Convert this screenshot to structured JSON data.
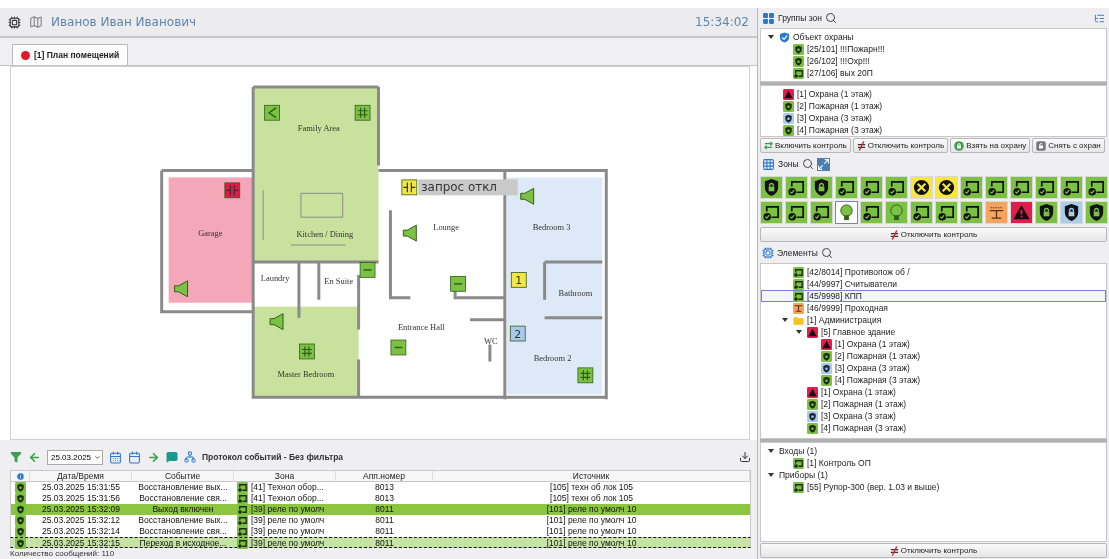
{
  "header": {
    "user": "Иванов Иван Иванович",
    "time": "15:34:02"
  },
  "tabs": [
    {
      "label": "[1] План помещений",
      "selected": true
    }
  ],
  "plan": {
    "areas": [
      {
        "color": "#c8e29d"
      },
      {
        "color": "#c8e29d"
      },
      {
        "color": "#f3a7b9"
      },
      {
        "color": "#dde9f6"
      }
    ],
    "room_labels": [
      "Family Area",
      "Garage",
      "Kitchen / Dining",
      "Laundry",
      "En Suite",
      "Lounge",
      "Bedroom 3",
      "Bathroom",
      "Entrance Hall",
      "WC",
      "Bedroom 2",
      "Master Bedroom"
    ],
    "markers": [
      {
        "kind": "sounder",
        "color": "#7cc242"
      },
      {
        "kind": "panel",
        "color": "#7cc242"
      },
      {
        "kind": "relay",
        "color": "#e0194b"
      },
      {
        "kind": "speaker",
        "color": "#7cc242"
      },
      {
        "kind": "relay",
        "color": "#f5e642",
        "caption": "запрос откл"
      },
      {
        "kind": "speaker",
        "color": "#7cc242"
      },
      {
        "kind": "speaker",
        "color": "#7cc242"
      },
      {
        "kind": "minus",
        "color": "#7cc242"
      },
      {
        "kind": "minus",
        "color": "#7cc242"
      },
      {
        "kind": "number",
        "color": "#f5e642",
        "label": "1"
      },
      {
        "kind": "number",
        "color": "#a9c8ea",
        "label": "2"
      },
      {
        "kind": "minus",
        "color": "#7cc242"
      },
      {
        "kind": "speaker",
        "color": "#7cc242"
      },
      {
        "kind": "panel",
        "color": "#7cc242"
      },
      {
        "kind": "panel",
        "color": "#7cc242"
      }
    ]
  },
  "events": {
    "date": "25.03.2025",
    "title": "Протокол событий - Без фильтра",
    "columns": [
      "Дата/Время",
      "Событие",
      "Зона",
      "Апп.номер",
      "Источник"
    ],
    "rows": [
      {
        "time": "25.03.2025 15:31:55",
        "event": "Восстановление вых...",
        "zone": "[41] Технол обор...",
        "number": "8013",
        "source": "[105] техн об лок 105",
        "color": "#ffffff",
        "focused": false
      },
      {
        "time": "25.03.2025 15:31:56",
        "event": "Восстановление свя...",
        "zone": "[41] Технол обор...",
        "number": "8013",
        "source": "[105] техн об лок 105",
        "color": "#ffffff",
        "focused": false
      },
      {
        "time": "25.03.2025 15:32:09",
        "event": "Выход включен",
        "zone": "[39] реле по умолч",
        "number": "8011",
        "source": "[101] реле по умолч 10",
        "color": "#8cc63f",
        "focused": false
      },
      {
        "time": "25.03.2025 15:32:12",
        "event": "Восстановление вых...",
        "zone": "[39] реле по умолч",
        "number": "8011",
        "source": "[101] реле по умолч 10",
        "color": "#ffffff",
        "focused": false
      },
      {
        "time": "25.03.2025 15:32:14",
        "event": "Восстановление свя...",
        "zone": "[39] реле по умолч",
        "number": "8011",
        "source": "[101] реле по умолч 10",
        "color": "#ffffff",
        "focused": false
      },
      {
        "time": "25.03.2025 15:32:15",
        "event": "Переход в исходное...",
        "zone": "[39] реле по умолч",
        "number": "8011",
        "source": "[101] реле по умолч 10",
        "color": "#c5e3a5",
        "focused": true
      }
    ],
    "footer": "Количество сообщений: 110"
  },
  "zone_groups": {
    "title": "Группы зон",
    "tree": [
      {
        "label": "Объект охраны",
        "kind": "object",
        "expanded": true,
        "children": [
          {
            "label": "[25/101] !!!Пожарн!!!",
            "kind": "fire"
          },
          {
            "label": "[26/102] !!!Охр!!!",
            "kind": "fire"
          },
          {
            "label": "[27/106] вых 20П",
            "kind": "loop"
          }
        ]
      }
    ],
    "list": [
      {
        "label": "[1] Охрана (1 этаж)",
        "kind": "alarm"
      },
      {
        "label": "[2] Пожарная (1 этаж)",
        "kind": "fire"
      },
      {
        "label": "[3] Охрана (3 этаж)",
        "kind": "guard"
      },
      {
        "label": "[4] Пожарная (3 этаж)",
        "kind": "fire"
      }
    ],
    "buttons": [
      {
        "label": "Включить контроль",
        "kind": "enable"
      },
      {
        "label": "Отключить контроль",
        "kind": "disable"
      },
      {
        "label": "Взять на охрану",
        "kind": "arm"
      },
      {
        "label": "Снять с охран",
        "kind": "disarm"
      }
    ]
  },
  "zones": {
    "title": "Зоны",
    "tiles": [
      {
        "kind": "lock",
        "selected": false
      },
      {
        "kind": "loop",
        "selected": false
      },
      {
        "kind": "lock",
        "selected": false
      },
      {
        "kind": "loop",
        "selected": false
      },
      {
        "kind": "loop",
        "selected": false
      },
      {
        "kind": "loop",
        "selected": false
      },
      {
        "kind": "fault",
        "selected": false
      },
      {
        "kind": "fault",
        "selected": false
      },
      {
        "kind": "loop",
        "selected": false
      },
      {
        "kind": "loop",
        "selected": false
      },
      {
        "kind": "loop",
        "selected": false
      },
      {
        "kind": "loop",
        "selected": false
      },
      {
        "kind": "loop",
        "selected": false
      },
      {
        "kind": "loop",
        "selected": false
      },
      {
        "kind": "loop",
        "selected": false
      },
      {
        "kind": "loop",
        "selected": false
      },
      {
        "kind": "loop",
        "selected": false
      },
      {
        "kind": "bulb",
        "selected": true
      },
      {
        "kind": "loop",
        "selected": false
      },
      {
        "kind": "bulb",
        "selected": false
      },
      {
        "kind": "loop",
        "selected": false
      },
      {
        "kind": "loop",
        "selected": false
      },
      {
        "kind": "loop",
        "selected": false
      },
      {
        "kind": "relay",
        "selected": false
      },
      {
        "kind": "alarm",
        "selected": false
      },
      {
        "kind": "lock",
        "selected": false
      },
      {
        "kind": "guard",
        "selected": false
      },
      {
        "kind": "lock",
        "selected": false
      }
    ],
    "button": {
      "label": "Отключить контроль",
      "kind": "disable"
    }
  },
  "elements": {
    "title": "Элементы",
    "tree": [
      {
        "label": "[42/8014] Противопож об /",
        "kind": "loop",
        "selected": false
      },
      {
        "label": "[44/9997] Считыватели",
        "kind": "loop",
        "selected": false
      },
      {
        "label": "[45/9998] КПП",
        "kind": "loop",
        "selected": true
      },
      {
        "label": "[46/9999] Проходная",
        "kind": "relay",
        "selected": false
      },
      {
        "label": "[1] Администрация",
        "kind": "folder",
        "selected": false,
        "expanded": true,
        "children": [
          {
            "label": "[5] Главное здание",
            "kind": "alarm",
            "selected": false,
            "expanded": true,
            "children": [
              {
                "label": "[1] Охрана (1 этаж)",
                "kind": "alarm",
                "selected": false
              },
              {
                "label": "[2] Пожарная (1 этаж)",
                "kind": "fire",
                "selected": false
              },
              {
                "label": "[3] Охрана (3 этаж)",
                "kind": "guard",
                "selected": false
              },
              {
                "label": "[4] Пожарная (3 этаж)",
                "kind": "fire",
                "selected": false
              }
            ]
          },
          {
            "label": "[1] Охрана (1 этаж)",
            "kind": "alarm",
            "selected": false
          },
          {
            "label": "[2] Пожарная (1 этаж)",
            "kind": "fire",
            "selected": false
          },
          {
            "label": "[3] Охрана (3 этаж)",
            "kind": "guard",
            "selected": false
          },
          {
            "label": "[4] Пожарная (3 этаж)",
            "kind": "fire",
            "selected": false
          }
        ]
      }
    ],
    "devices": [
      {
        "label": "Входы (1)",
        "expanded": true,
        "children": [
          {
            "label": "[1] Контроль ОП",
            "kind": "loop"
          }
        ]
      },
      {
        "label": "Приборы (1)",
        "expanded": true,
        "children": [
          {
            "label": "[55] Рупор-300 (вер. 1.03 и выше)",
            "kind": "loop"
          }
        ]
      }
    ],
    "button": {
      "label": "Отключить контроль",
      "kind": "disable"
    }
  }
}
